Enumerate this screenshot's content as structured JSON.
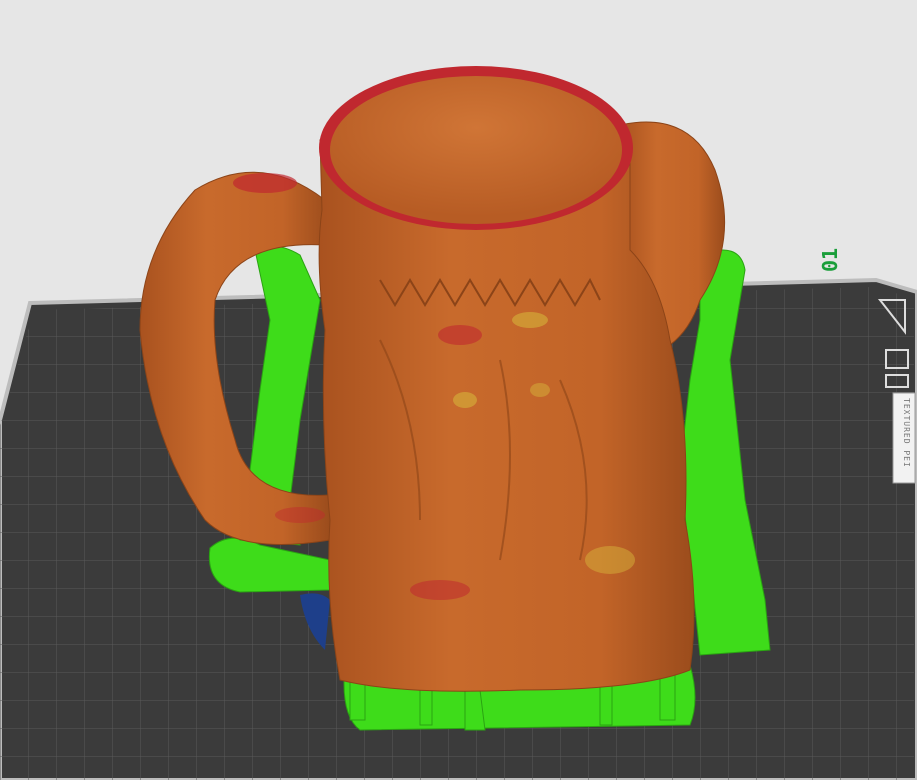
{
  "plate": {
    "label": "01",
    "notch_text": "TEXTURED PEI"
  },
  "model": {
    "name": "mug",
    "colors": {
      "body": "#c4652a",
      "body_shadow": "#9a4b1c",
      "rim": "#c0282f",
      "highlight": "#d6b23a",
      "supports": "#3edc1a",
      "bed": "#3a3a3a",
      "grid": "#555555",
      "bed_edge": "#cfcfcf"
    }
  }
}
